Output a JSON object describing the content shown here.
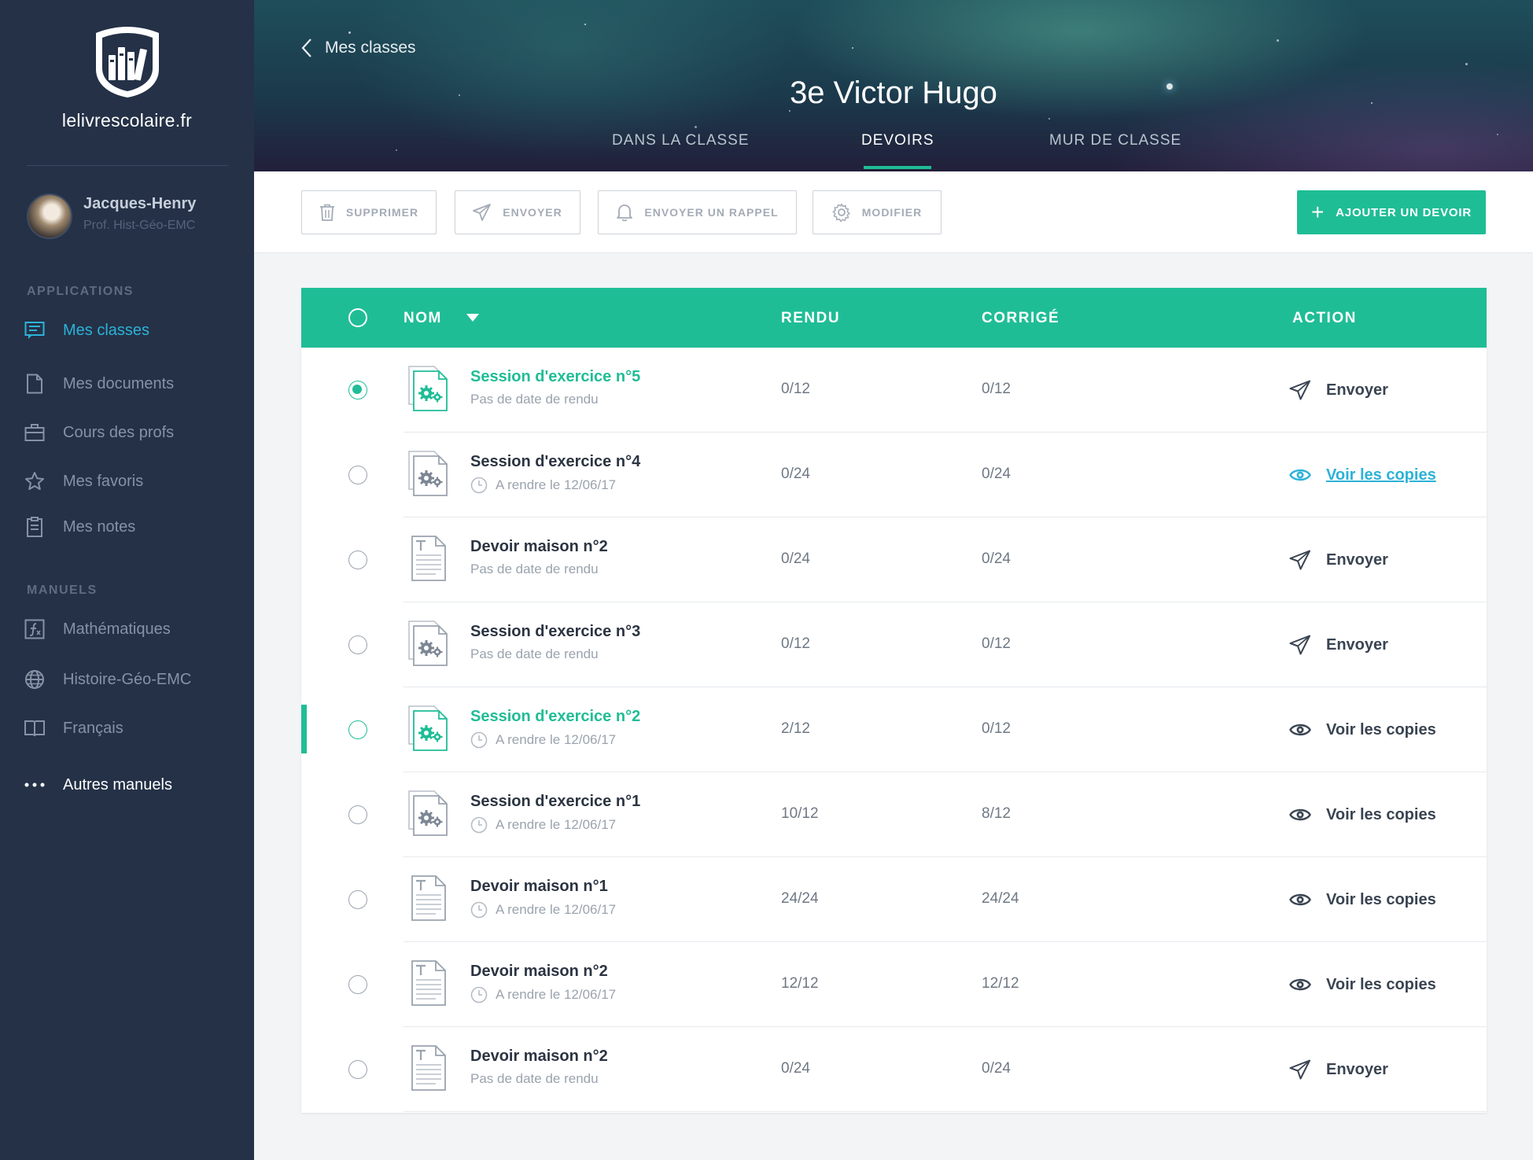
{
  "app": {
    "logo_text": "lelivrescolaire.fr"
  },
  "user": {
    "name": "Jacques-Henry",
    "role": "Prof. Hist-Géo-EMC"
  },
  "sidebar": {
    "applications_label": "APPLICATIONS",
    "applications": [
      {
        "label": "Mes classes",
        "icon": "classes-icon",
        "active": true
      },
      {
        "label": "Mes documents",
        "icon": "document-icon"
      },
      {
        "label": "Cours des profs",
        "icon": "briefcase-icon"
      },
      {
        "label": "Mes favoris",
        "icon": "star-icon"
      },
      {
        "label": "Mes notes",
        "icon": "clipboard-icon"
      }
    ],
    "manuels_label": "MANUELS",
    "manuels": [
      {
        "label": "Mathématiques",
        "icon": "math-icon"
      },
      {
        "label": "Histoire-Géo-EMC",
        "icon": "globe-icon"
      },
      {
        "label": "Français",
        "icon": "book-icon"
      },
      {
        "label": "Autres manuels",
        "icon": "more-dots-icon"
      }
    ]
  },
  "header": {
    "back_label": "Mes classes",
    "title": "3e Victor Hugo",
    "tabs": [
      {
        "label": "DANS LA CLASSE",
        "active": false
      },
      {
        "label": "DEVOIRS",
        "active": true
      },
      {
        "label": "MUR DE CLASSE",
        "active": false
      }
    ]
  },
  "toolbar": {
    "delete_label": "SUPPRIMER",
    "send_label": "ENVOYER",
    "reminder_label": "ENVOYER UN RAPPEL",
    "edit_label": "MODIFIER",
    "add_label": "AJOUTER UN DEVOIR"
  },
  "colors": {
    "accent": "#1fbd96",
    "link": "#2db2d8",
    "sidebar_bg": "#243147"
  },
  "table": {
    "columns": {
      "name": "NOM",
      "rendu": "RENDU",
      "corrige": "CORRIGÉ",
      "action": "ACTION"
    },
    "rows": [
      {
        "name": "Session d'exercice n°5",
        "sub": "Pas de date de rendu",
        "has_clock": false,
        "type": "exercise",
        "rendu": "0/12",
        "corrige": "0/12",
        "action": "Envoyer",
        "action_type": "send",
        "highlight": true,
        "checked": true
      },
      {
        "name": "Session d'exercice n°4",
        "sub": "A rendre le 12/06/17",
        "has_clock": true,
        "type": "exercise",
        "rendu": "0/24",
        "corrige": "0/24",
        "action": "Voir les copies",
        "action_type": "view-link"
      },
      {
        "name": "Devoir maison n°2",
        "sub": "Pas de date de rendu",
        "has_clock": false,
        "type": "text",
        "rendu": "0/24",
        "corrige": "0/24",
        "action": "Envoyer",
        "action_type": "send"
      },
      {
        "name": "Session d'exercice n°3",
        "sub": "Pas de date de rendu",
        "has_clock": false,
        "type": "exercise",
        "rendu": "0/12",
        "corrige": "0/12",
        "action": "Envoyer",
        "action_type": "send"
      },
      {
        "name": "Session d'exercice n°2",
        "sub": "A rendre le 12/06/17",
        "has_clock": true,
        "type": "exercise",
        "rendu": "2/12",
        "corrige": "0/12",
        "action": "Voir les copies",
        "action_type": "view",
        "highlight": true,
        "marker": true
      },
      {
        "name": "Session d'exercice n°1",
        "sub": "A rendre le 12/06/17",
        "has_clock": true,
        "type": "exercise",
        "rendu": "10/12",
        "corrige": "8/12",
        "action": "Voir les copies",
        "action_type": "view"
      },
      {
        "name": "Devoir maison n°1",
        "sub": "A rendre le 12/06/17",
        "has_clock": true,
        "type": "text",
        "rendu": "24/24",
        "corrige": "24/24",
        "action": "Voir les copies",
        "action_type": "view"
      },
      {
        "name": "Devoir maison n°2",
        "sub": "A rendre le 12/06/17",
        "has_clock": true,
        "type": "text",
        "rendu": "12/12",
        "corrige": "12/12",
        "action": "Voir les copies",
        "action_type": "view"
      },
      {
        "name": "Devoir maison n°2",
        "sub": "Pas de date de rendu",
        "has_clock": false,
        "type": "text",
        "rendu": "0/24",
        "corrige": "0/24",
        "action": "Envoyer",
        "action_type": "send"
      }
    ]
  }
}
